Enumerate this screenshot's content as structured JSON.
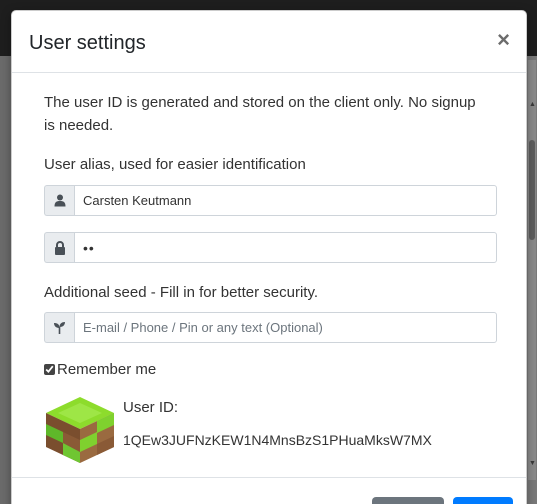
{
  "modal": {
    "title": "User settings",
    "close_symbol": "×",
    "intro": "The user ID is generated and stored on the client only. No signup is needed.",
    "alias_label": "User alias, used for easier identification",
    "alias_value": "Carsten Keutmann",
    "password_value": "••",
    "seed_label": "Additional seed - Fill in for better security.",
    "seed_placeholder": "E-mail / Phone / Pin or any text (Optional)",
    "remember_label": "Remember me",
    "remember_checked": true,
    "userid_label": "User ID:",
    "userid_value": "1QEw3JUFNzKEW1N4MnsBzS1PHuaMksW7MX"
  },
  "icons": {
    "alias": "user-icon",
    "password": "lock-icon",
    "seed": "seedling-icon",
    "identicon": "identicon-cube"
  },
  "colors": {
    "primary": "#007bff",
    "secondary": "#6c757d",
    "identicon_green": "#8ddc2c",
    "identicon_brown": "#8a5a36"
  }
}
